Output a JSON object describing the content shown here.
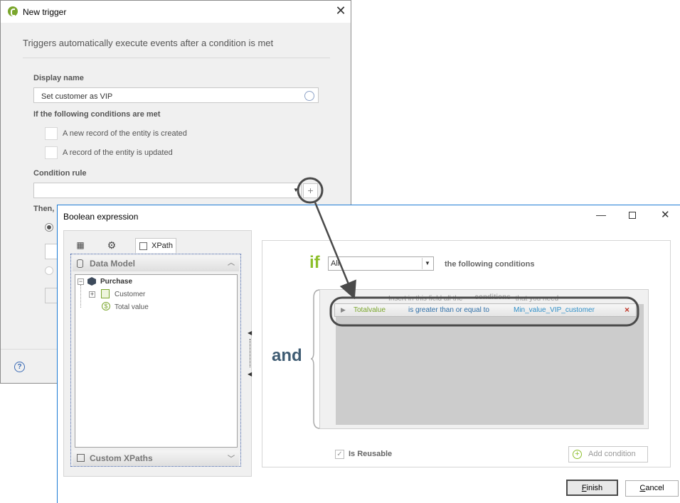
{
  "trigger_window": {
    "title": "New trigger",
    "description": "Triggers automatically execute events after a condition is met",
    "display_name_label": "Display name",
    "display_name_value": "Set customer as VIP",
    "conditions_label": "If the following conditions are met",
    "checkbox_created": "A new record of the entity is created",
    "checkbox_updated": "A record of the entity is updated",
    "condition_rule_label": "Condition rule",
    "condition_rule_value": "",
    "then_label": "Then,",
    "help_icon": "?"
  },
  "boolean_window": {
    "title": "Boolean expression",
    "left_panel": {
      "tab_xpath": "XPath",
      "data_model_header": "Data Model",
      "tree": {
        "root": "Purchase",
        "children": [
          "Customer",
          "Total value"
        ]
      },
      "custom_xpaths_header": "Custom XPaths"
    },
    "if_keyword": "if",
    "quantifier_value": "All",
    "following_conditions": "the following conditions",
    "and_keyword": "and",
    "hint_text": "Insert in this field all the conditions that you need",
    "hint_part1": "Insert in this field all the",
    "hint_part2": "conditions",
    "hint_part3": "that you need",
    "condition_row": {
      "left": "Totalvalue",
      "operator": "is greater than or equal to",
      "right": "Min_value_VIP_customer",
      "remove": "×"
    },
    "is_reusable_label": "Is Reusable",
    "add_condition_label": "Add condition",
    "finish_accel": "F",
    "finish_rest": "inish",
    "cancel_accel": "C",
    "cancel_rest": "ancel"
  },
  "colors": {
    "if_green": "#8dbf2c",
    "and_blue": "#3f5c73",
    "operator_blue": "#2f6fa8",
    "annotation": "#4a4a4a"
  }
}
